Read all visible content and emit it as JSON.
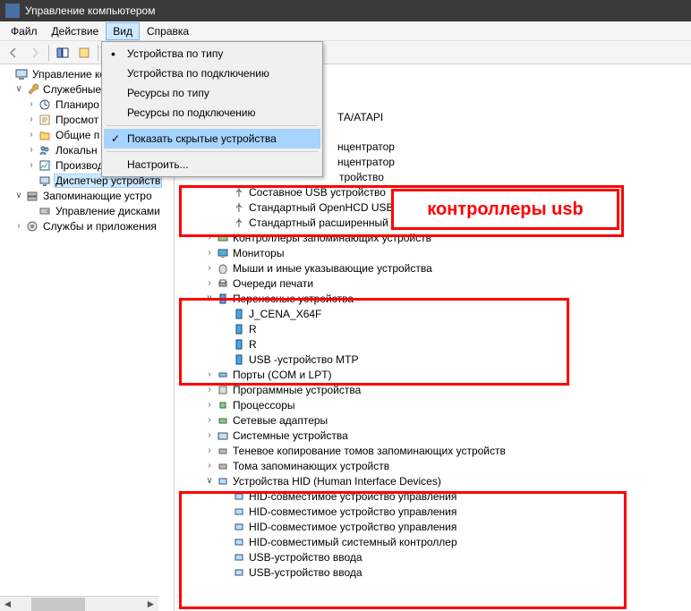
{
  "window": {
    "title": "Управление компьютером"
  },
  "menubar": {
    "file": "Файл",
    "action": "Действие",
    "view": "Вид",
    "help": "Справка"
  },
  "dropdown": {
    "by_type": "Устройства по типу",
    "by_connection": "Устройства по подключению",
    "res_by_type": "Ресурсы по типу",
    "res_by_conn": "Ресурсы по подключению",
    "show_hidden": "Показать скрытые устройства",
    "customize": "Настроить..."
  },
  "left_tree": {
    "root": "Управление ком",
    "services": "Служебные",
    "scheduler": "Планиро",
    "eventvwr": "Просмот",
    "shares": "Общие п",
    "localusers": "Локальн",
    "perf": "Производ",
    "devmgr": "Диспетчер устройств",
    "storage": "Запоминающие устро",
    "diskmgmt": "Управление дисками",
    "svcapps": "Службы и приложения"
  },
  "dev_tree": {
    "atapi": "ТА/ATAPI",
    "hub1": "нцентратор",
    "hub2": "нцентратор",
    "usb_dev1": "тройство",
    "composite": "Составное USB устройство",
    "openhcd": "Стандартный OpenHCD USB ",
    "ext": "Стандартный расширенный",
    "storage_ctrl": "Контроллеры запоминающих устройств",
    "monitors": "Мониторы",
    "mice": "Мыши и иные указывающие устройства",
    "print_queues": "Очереди печати",
    "portable": "Переносные устройства",
    "jcena": "J_CENA_X64F",
    "r1": "R",
    "r2": "R",
    "mtp": "USB -устройство MTP",
    "ports": "Порты (COM и LPT)",
    "software": "Программные устройства",
    "cpus": "Процессоры",
    "netadapters": "Сетевые адаптеры",
    "sysdevices": "Системные устройства",
    "shadowcopy": "Теневое копирование томов запоминающих устройств",
    "volumes": "Тома запоминающих устройств",
    "hid_root": "Устройства HID (Human Interface Devices)",
    "hid1": "HID-совместимое устройство управления",
    "hid2": "HID-совместимое устройство управления",
    "hid3": "HID-совместимое устройство управления",
    "hid4": "HID-совместимый системный контроллер",
    "usb_input1": "USB-устройство ввода",
    "usb_input2": "USB-устройство ввода"
  },
  "annotation": {
    "usb_controllers": "контроллеры usb"
  }
}
